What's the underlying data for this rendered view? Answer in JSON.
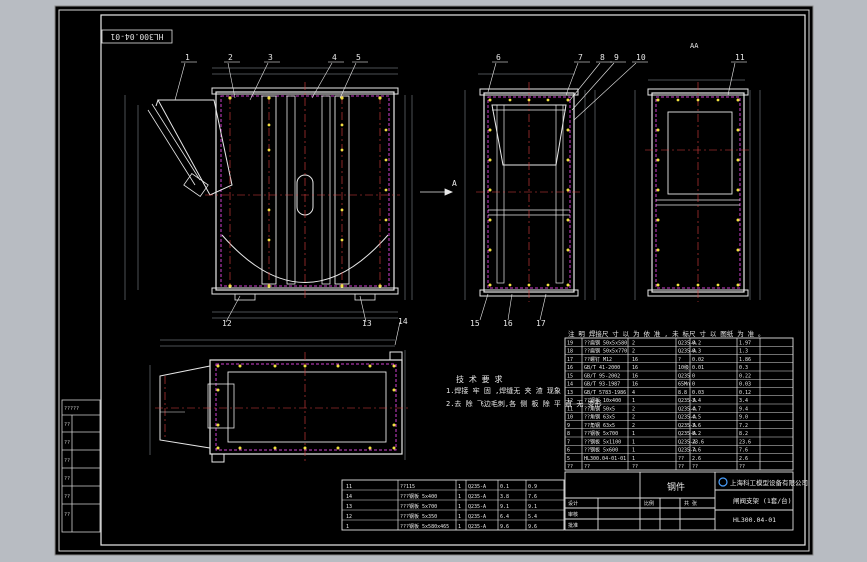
{
  "drawing": {
    "code_stamp": "HL300.04-01",
    "section_mark": "AA",
    "cut_letter": "A",
    "part_callouts_top": [
      "1",
      "2",
      "3",
      "4",
      "5",
      "6",
      "7",
      "8",
      "9",
      "10",
      "11"
    ],
    "part_callouts_bottom": [
      "12",
      "13",
      "14",
      "15",
      "16",
      "17"
    ],
    "tech_req": {
      "title": "技 术 要 求",
      "line1": "1.焊接 牢 固 ,焊缝无 夹 渣 现象",
      "line2": "2.去 除 飞边毛刺,各 侧 板 除 平 直 无 变形"
    },
    "bom_header_note": "注 明 焊接尺 寸 以 为 依 准 , 未 标尺 寸 以 图纸 为 准 。",
    "bom_rows": [
      {
        "no": "19",
        "code": "??扁钢 50x5x580",
        "qty": "2",
        "mat": "Q235-A",
        "w": "0.2",
        "t": "1.97"
      },
      {
        "no": "18",
        "code": "??扁钢 50x5x770",
        "qty": "2",
        "mat": "Q235-A",
        "w": "0.3",
        "t": "1.3"
      },
      {
        "no": "17",
        "code": "??螺钉 M12",
        "qty": "16",
        "mat": "?",
        "w": "0.02",
        "t": "1.86"
      },
      {
        "no": "16",
        "code": "GB/T 41-2000",
        "qty": "16",
        "mat": "10级",
        "w": "0.01",
        "t": "0.3"
      },
      {
        "no": "15",
        "code": "GB/T 95-2002",
        "qty": "16",
        "mat": "Q235",
        "w": "0",
        "t": "0.22"
      },
      {
        "no": "14",
        "code": "GB/T 93-1987",
        "qty": "16",
        "mat": "65Mn",
        "w": "0",
        "t": "0.03"
      },
      {
        "no": "13",
        "code": "GB/T 5783-1986",
        "qty": "4",
        "mat": "8.8",
        "w": "0.03",
        "t": "0.12"
      },
      {
        "no": "12",
        "code": "??钢板 10x400",
        "qty": "1",
        "mat": "Q235-A",
        "w": "3.4",
        "t": "3.4"
      },
      {
        "no": "11",
        "code": "??角钢 50x5",
        "qty": "2",
        "mat": "Q235-A",
        "w": "4.7",
        "t": "9.4"
      },
      {
        "no": "10",
        "code": "??角钢 63x5",
        "qty": "2",
        "mat": "Q235-A",
        "w": "4.5",
        "t": "9.0"
      },
      {
        "no": "9",
        "code": "??角钢 63x5",
        "qty": "2",
        "mat": "Q235-A",
        "w": "3.6",
        "t": "7.2"
      },
      {
        "no": "8",
        "code": "??钢板 5x700",
        "qty": "1",
        "mat": "Q235-A",
        "w": "8.2",
        "t": "8.2"
      },
      {
        "no": "7",
        "code": "??钢板 5x1100",
        "qty": "1",
        "mat": "Q235-A",
        "w": "23.6",
        "t": "23.6"
      },
      {
        "no": "6",
        "code": "??钢板 5x600",
        "qty": "1",
        "mat": "Q235-A",
        "w": "7.6",
        "t": "7.6"
      },
      {
        "no": "5",
        "code": "HL300.04-01-01",
        "qty": "1",
        "mat": "??",
        "w": "2.6",
        "t": "2.6"
      },
      {
        "no": "??",
        "code": "??",
        "qty": "??",
        "mat": "??",
        "w": "??",
        "t": "??"
      }
    ],
    "bom_left_rows": [
      {
        "no": "11",
        "code": "??115",
        "qty": "1",
        "mat": "Q235-A",
        "w": "0.1",
        "t": "0.9"
      },
      {
        "no": "14",
        "code": "???钢板 5x400",
        "qty": "1",
        "mat": "Q235-A",
        "w": "3.8",
        "t": "7.6"
      },
      {
        "no": "13",
        "code": "???钢板 5x700",
        "qty": "1",
        "mat": "Q235-A",
        "w": "9.1",
        "t": "9.1"
      },
      {
        "no": "12",
        "code": "???钢板 5x350",
        "qty": "1",
        "mat": "Q235-A",
        "w": "6.4",
        "t": "5.4"
      },
      {
        "no": "1",
        "code": "???钢板 5x580x465",
        "qty": "1",
        "mat": "Q235-A",
        "w": "9.6",
        "t": "9.6"
      }
    ],
    "title_block": {
      "company": "上海科工模型设备有限公司",
      "part_type": "钢件",
      "name": "闸阀支架 (1套/台)",
      "drawing_no": "HL300.04-01",
      "scale_label": "比例",
      "sheet_label": "共 张",
      "design": "设计",
      "check": "审核",
      "approve": "批准"
    },
    "left_margin_labels": [
      "?????",
      "??",
      "??",
      "??",
      "??",
      "??",
      "??"
    ]
  }
}
